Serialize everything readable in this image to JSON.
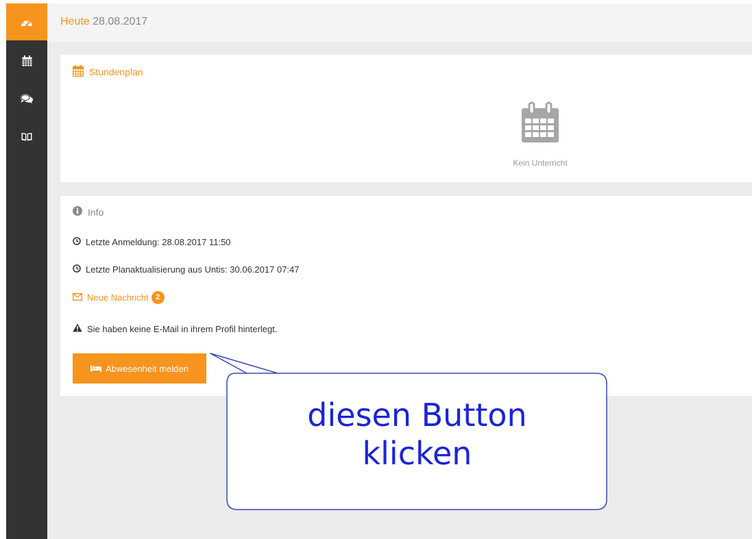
{
  "header": {
    "title_prefix": "Heute",
    "date": "28.08.2017"
  },
  "sidebar": {
    "items": [
      {
        "name": "dashboard",
        "icon": "dashboard-icon",
        "active": true
      },
      {
        "name": "calendar",
        "icon": "calendar-icon",
        "active": false
      },
      {
        "name": "messages",
        "icon": "chat-icon",
        "active": false
      },
      {
        "name": "book",
        "icon": "book-icon",
        "active": false
      }
    ]
  },
  "schedule": {
    "title": "Stundenplan",
    "icon": "calendar-icon",
    "empty_icon": "calendar-icon",
    "empty_text": "Kein Unterricht"
  },
  "info": {
    "title": "Info",
    "icon": "info-circle-icon",
    "last_login": "Letzte Anmeldung: 28.08.2017 11:50",
    "last_plan_update": "Letzte Planaktualisierung aus Untis: 30.06.2017 07:47",
    "new_message_label": "Neue Nachricht",
    "new_message_count": "2",
    "email_warning": "Sie haben keine E-Mail in ihrem Profil hinterlegt.",
    "absence_button_label": "Abwesenheit melden"
  },
  "callout": {
    "line1": "diesen Button",
    "line2": "klicken"
  },
  "colors": {
    "accent": "#f7941d",
    "sidebar": "#333333",
    "background": "#ececec",
    "callout_text": "#1a24d8",
    "callout_border": "#3a47b4"
  }
}
